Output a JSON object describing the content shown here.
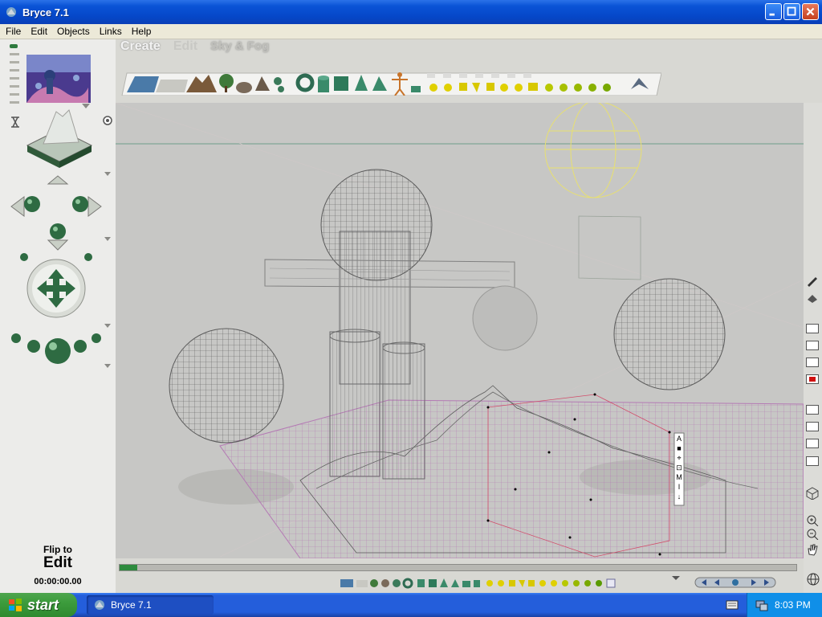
{
  "window": {
    "title": "Bryce 7.1"
  },
  "menu": [
    "File",
    "Edit",
    "Objects",
    "Links",
    "Help"
  ],
  "tabs": {
    "create": "Create",
    "edit": "Edit",
    "sky_fog": "Sky & Fog"
  },
  "left_palette": {
    "flip_line1": "Flip to",
    "flip_line2": "Edit",
    "timecode": "00:00:00.00"
  },
  "viewport_tools": [
    "A",
    "■",
    "⌖",
    "⊡",
    "M",
    "I",
    "↓"
  ],
  "taskbar": {
    "start_label": "start",
    "task_item": "Bryce 7.1",
    "clock": "8:03 PM"
  }
}
